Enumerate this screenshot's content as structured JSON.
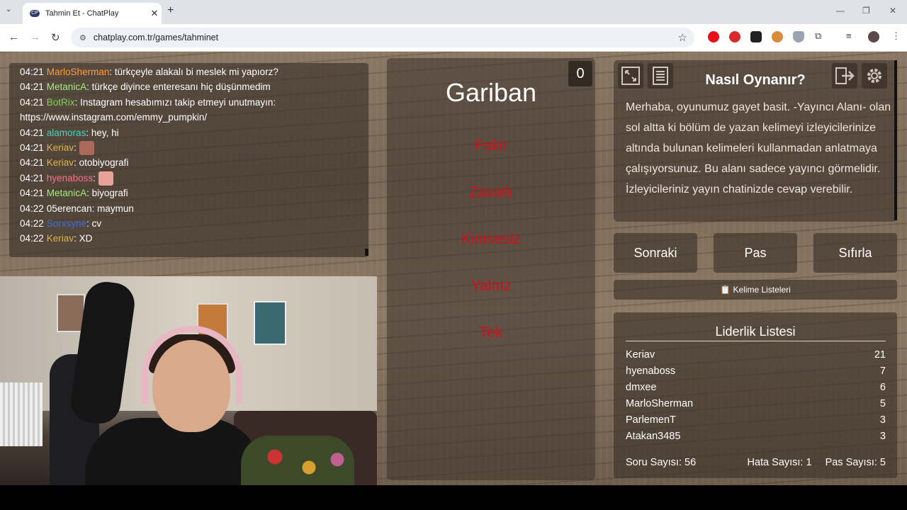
{
  "browser": {
    "tab_title": "Tahmin Et - ChatPlay",
    "tab_favicon": "CP",
    "url": "chatplay.com.tr/games/tahminet"
  },
  "chat": {
    "messages": [
      {
        "time": "04:21",
        "user": "MarloSherman",
        "color": "#ff9a3c",
        "text": ": türkçeyle alakalı bi meslek mi yapıorz?"
      },
      {
        "time": "04:21",
        "user": "MetanicA",
        "color": "#9ef07a",
        "text": ": türkçe diyince enteresanı hiç düşünmedim"
      },
      {
        "time": "04:21",
        "user": "BotRix",
        "color": "#7bd94f",
        "text": ": Instagram hesabımızı takip etmeyi unutmayın:"
      },
      {
        "time": "",
        "user": "",
        "color": "#ffffff",
        "text": "https://www.instagram.com/emmy_pumpkin/"
      },
      {
        "time": "04:21",
        "user": "alamoras",
        "color": "#3fd6c0",
        "text": ": hey, hi"
      },
      {
        "time": "04:21",
        "user": "Keriav",
        "color": "#e0b24a",
        "text": ":",
        "emote": "#a86a5a"
      },
      {
        "time": "04:21",
        "user": "Keriav",
        "color": "#e0b24a",
        "text": ": otobiyografi"
      },
      {
        "time": "04:21",
        "user": "hyenaboss",
        "color": "#ff6f8a",
        "text": ":",
        "emote": "#e8a29a"
      },
      {
        "time": "04:21",
        "user": "MetanicA",
        "color": "#9ef07a",
        "text": ": biyografi"
      },
      {
        "time": "04:22",
        "user": "05erencan",
        "color": "#ffffff",
        "text": ": maymun"
      },
      {
        "time": "04:22",
        "user": "Sorxsyne",
        "color": "#3f6fe0",
        "text": ": cv"
      },
      {
        "time": "04:22",
        "user": "Keriav",
        "color": "#e0b24a",
        "text": ": XD"
      }
    ]
  },
  "card": {
    "counter": "0",
    "word": "Gariban",
    "forbidden": [
      "Fakir",
      "Zavallı",
      "Kimsesiz",
      "Yalnız",
      "Tek"
    ]
  },
  "howto": {
    "title": "Nasıl Oynanır?",
    "text": "Merhaba, oyunumuz gayet basit. -Yayıncı Alanı- olan sol altta ki bölüm de yazan kelimeyi izleyicilerinize altında bulunan kelimeleri kullanmadan anlatmaya çalışıyorsunuz. Bu alanı sadece yayıncı görmelidir. İzleyicileriniz yayın chatinizde cevap verebilir."
  },
  "actions": {
    "next": "Sonraki",
    "pass": "Pas",
    "reset": "Sıfırla",
    "word_lists": "📋 Kelime Listeleri"
  },
  "leaderboard": {
    "title": "Liderlik Listesi",
    "rows": [
      {
        "name": "Keriav",
        "score": "21"
      },
      {
        "name": "hyenaboss",
        "score": "7"
      },
      {
        "name": "dmxee",
        "score": "6"
      },
      {
        "name": "MarloSherman",
        "score": "5"
      },
      {
        "name": "ParlemenT",
        "score": "3"
      },
      {
        "name": "Atakan3485",
        "score": "3"
      }
    ],
    "question_count": "Soru Sayısı: 56",
    "error_count": "Hata Sayısı: 1",
    "pass_count": "Pas Sayısı: 5"
  }
}
